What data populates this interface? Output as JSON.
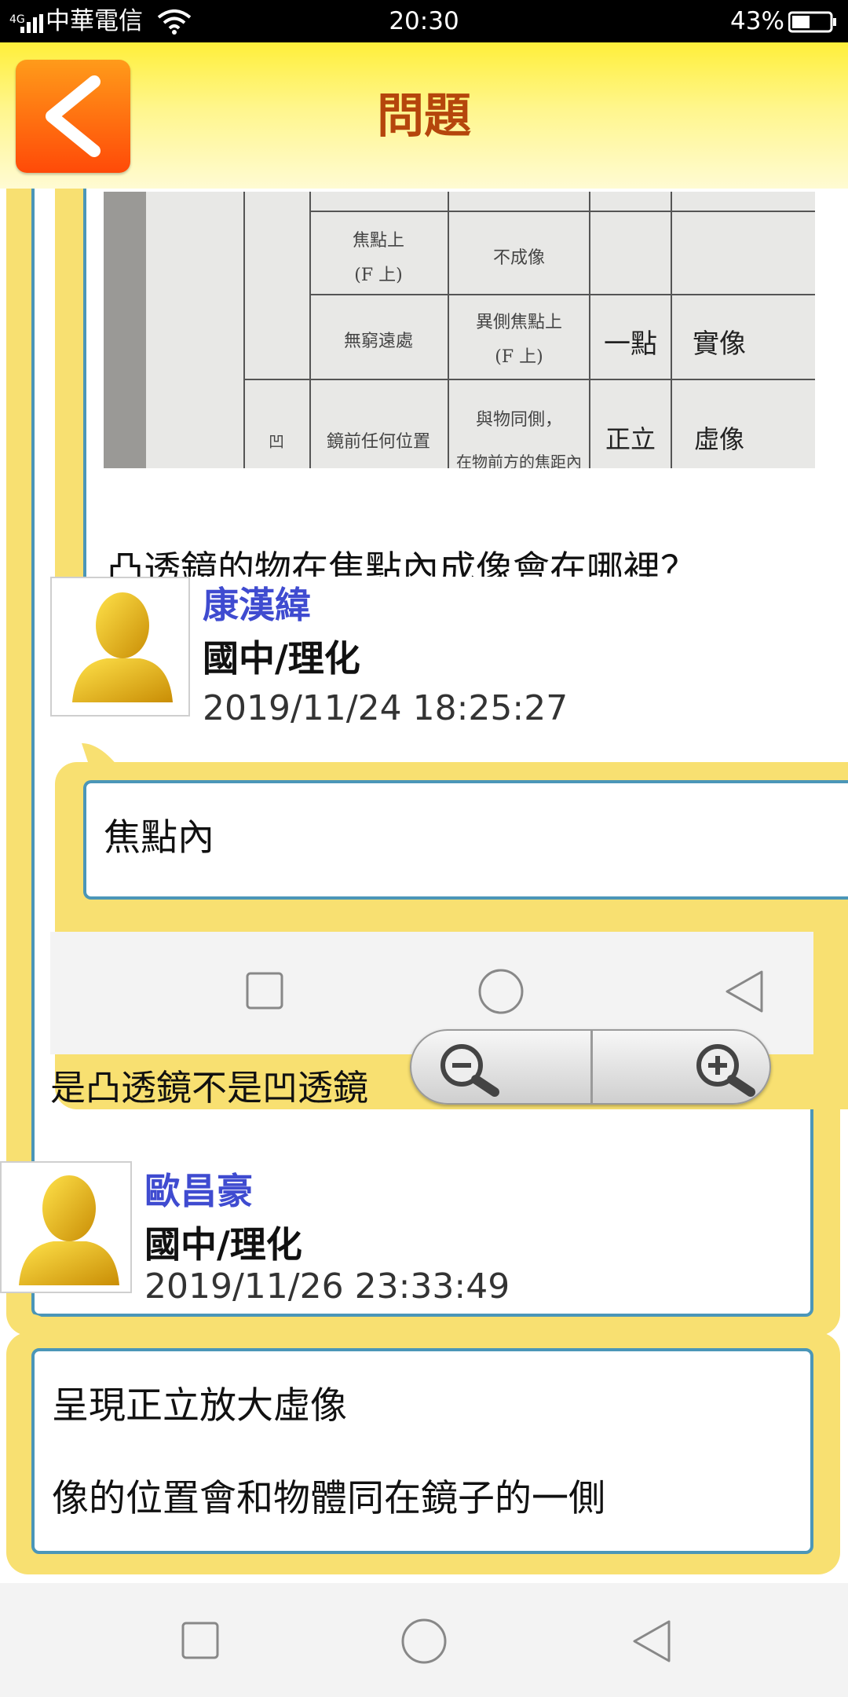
{
  "status_bar": {
    "network": "4G",
    "carrier": "中華電信",
    "time": "20:30",
    "battery": "43%"
  },
  "header": {
    "title": "問題"
  },
  "question": {
    "photo_cells": {
      "r1c1": "焦點上",
      "r1c1b": "(F 上)",
      "r1c2": "不成像",
      "r2c1": "無窮遠處",
      "r2c2": "異側焦點上",
      "r2c2b": "(F 上)",
      "r2c3": "一點",
      "r2c4": "實像",
      "r3c0": "凹",
      "r3c1": "鏡前任何位置",
      "r3c2": "與物同側，",
      "r3c2b": "在物前方的焦距內",
      "r3c3": "正立",
      "r3c4": "虛像"
    },
    "text": "凸透鏡的物在焦點內成像會在哪裡？"
  },
  "answers": [
    {
      "name": "康漢緯",
      "subject": "國中/理化",
      "timestamp": "2019/11/24 18:25:27",
      "text": "焦點內"
    },
    {
      "text": "是凸透鏡不是凹透鏡"
    },
    {
      "name": "歐昌豪",
      "subject": "國中/理化",
      "timestamp": "2019/11/26 23:33:49",
      "line1": "呈現正立放大虛像",
      "line2": "像的位置會和物體同在鏡子的一側"
    }
  ],
  "icons": [
    "back-arrow-icon",
    "wifi-icon",
    "signal-icon",
    "battery-icon",
    "avatar-icon",
    "zoom-out-icon",
    "zoom-in-icon",
    "recent-apps-icon",
    "home-icon",
    "back-nav-icon"
  ],
  "colors": {
    "header_yellow": "#ffef3a",
    "title_brown": "#b5460c",
    "card_yellow": "#f8e071",
    "box_border": "#4b96b8",
    "name_blue": "#3f4bd0"
  }
}
